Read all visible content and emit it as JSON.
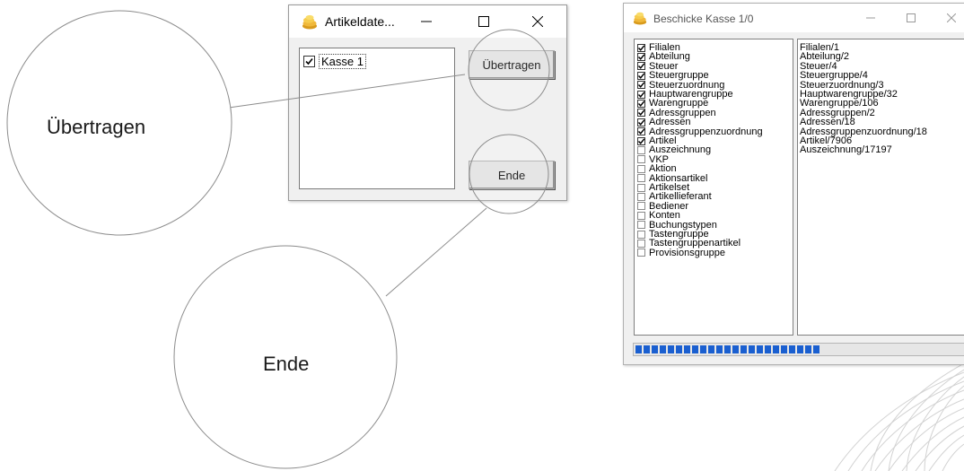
{
  "small_window": {
    "title": "Artikeldate...",
    "list_items": [
      {
        "label": "Kasse 1",
        "checked": true
      }
    ],
    "transfer_label": "Übertragen",
    "end_label": "Ende"
  },
  "callouts": {
    "transfer": "Übertragen",
    "end": "Ende"
  },
  "large_window": {
    "title": "Beschicke Kasse 1/0",
    "checklist": [
      {
        "label": "Filialen",
        "checked": true
      },
      {
        "label": "Abteilung",
        "checked": true
      },
      {
        "label": "Steuer",
        "checked": true
      },
      {
        "label": "Steuergruppe",
        "checked": true
      },
      {
        "label": "Steuerzuordnung",
        "checked": true
      },
      {
        "label": "Hauptwarengruppe",
        "checked": true
      },
      {
        "label": "Warengruppe",
        "checked": true
      },
      {
        "label": "Adressgruppen",
        "checked": true
      },
      {
        "label": "Adressen",
        "checked": true
      },
      {
        "label": "Adressgruppenzuordnung",
        "checked": true
      },
      {
        "label": "Artikel",
        "checked": true
      },
      {
        "label": "Auszeichnung",
        "checked": false
      },
      {
        "label": "VKP",
        "checked": false
      },
      {
        "label": "Aktion",
        "checked": false
      },
      {
        "label": "Aktionsartikel",
        "checked": false
      },
      {
        "label": "Artikelset",
        "checked": false
      },
      {
        "label": "Artikellieferant",
        "checked": false
      },
      {
        "label": "Bediener",
        "checked": false
      },
      {
        "label": "Konten",
        "checked": false
      },
      {
        "label": "Buchungstypen",
        "checked": false
      },
      {
        "label": "Tastengruppe",
        "checked": false
      },
      {
        "label": "Tastengruppenartikel",
        "checked": false
      },
      {
        "label": "Provisionsgruppe",
        "checked": false
      }
    ],
    "log": [
      "Filialen/1",
      "Abteilung/2",
      "Steuer/4",
      "Steuergruppe/4",
      "Steuerzuordnung/3",
      "Hauptwarengruppe/32",
      "Warengruppe/106",
      "Adressgruppen/2",
      "Adressen/18",
      "Adressgruppenzuordnung/18",
      "Artikel/7906",
      "Auszeichnung/17197"
    ],
    "progress_fraction": 0.57,
    "progress_color": "#1a5fd0"
  }
}
